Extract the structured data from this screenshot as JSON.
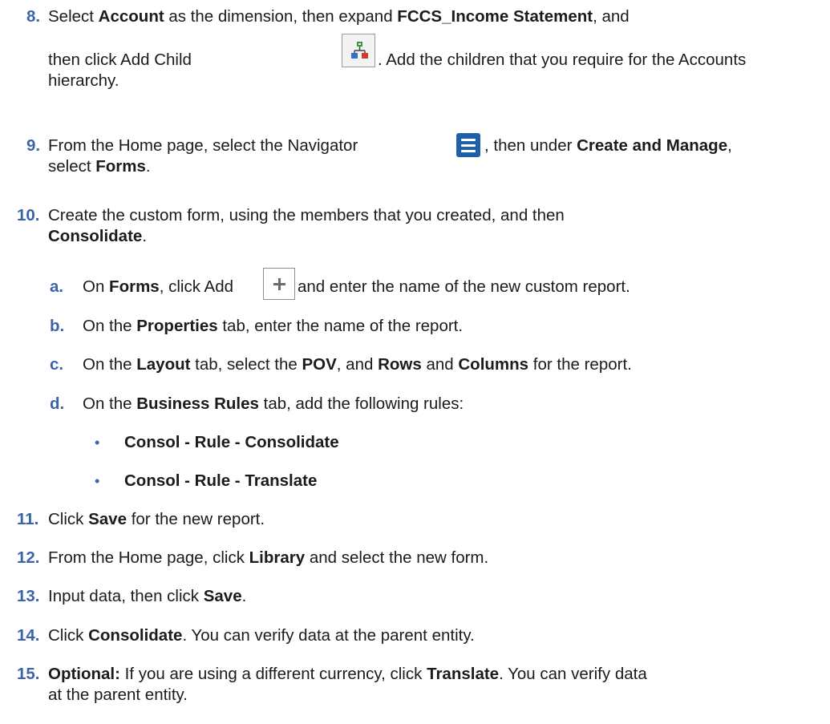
{
  "steps": {
    "s8": {
      "num": "8.",
      "l1_a": "Select ",
      "l1_b": "Account",
      "l1_c": " as the dimension, then expand ",
      "l1_d": "FCCS_Income Statement",
      "l1_e": ", and",
      "l2_a": "then click Add Child ",
      "l2_b": ". Add the children that you require for the Accounts",
      "l3": "hierarchy."
    },
    "s9": {
      "num": "9.",
      "l1_a": "From the Home page, select the Navigator ",
      "l1_b": ", then under ",
      "l1_c": "Create and Manage",
      "l1_d": ",",
      "l2_a": "select ",
      "l2_b": "Forms",
      "l2_c": "."
    },
    "s10": {
      "num": "10.",
      "l1": "Create the custom form, using the members that you created, and then",
      "l2_a": "Consolidate",
      "l2_b": ".",
      "a": {
        "label": "a.",
        "t1": "On ",
        "t2": "Forms",
        "t3": ", click Add ",
        "t4": " and enter the name of the new custom report."
      },
      "b": {
        "label": "b.",
        "t1": "On the ",
        "t2": "Properties",
        "t3": " tab, enter the name of the report."
      },
      "c": {
        "label": "c.",
        "t1": "On the ",
        "t2": "Layout",
        "t3": " tab, select the ",
        "t4": "POV",
        "t5": ", and ",
        "t6": "Rows",
        "t7": " and ",
        "t8": "Columns",
        "t9": " for the report."
      },
      "d": {
        "label": "d.",
        "t1": "On the ",
        "t2": "Business Rules",
        "t3": " tab, add the following rules:",
        "bullets": [
          "Consol - Rule - Consolidate",
          "Consol - Rule - Translate"
        ]
      }
    },
    "s11": {
      "num": "11.",
      "t1": "Click ",
      "t2": "Save",
      "t3": " for the new report."
    },
    "s12": {
      "num": "12.",
      "t1": "From the Home page, click ",
      "t2": "Library",
      "t3": " and select the new form."
    },
    "s13": {
      "num": "13.",
      "t1": "Input data, then click ",
      "t2": "Save",
      "t3": "."
    },
    "s14": {
      "num": "14.",
      "t1": "Click ",
      "t2": "Consolidate",
      "t3": ". You can verify data at the parent entity."
    },
    "s15": {
      "num": "15.",
      "t1": "Optional:",
      "t2": " If you are using a different currency, click ",
      "t3": "Translate",
      "t4": ". You can verify data",
      "l2": "at the parent entity."
    }
  },
  "bullet_glyph": "•",
  "icons": {
    "add_child": "add-child-icon",
    "navigator": "navigator-menu-icon",
    "add": "add-plus-icon"
  },
  "colors": {
    "step_number": "#3b63a8",
    "navigator_icon": "#1f5fa8",
    "text": "#1b1b1b"
  }
}
